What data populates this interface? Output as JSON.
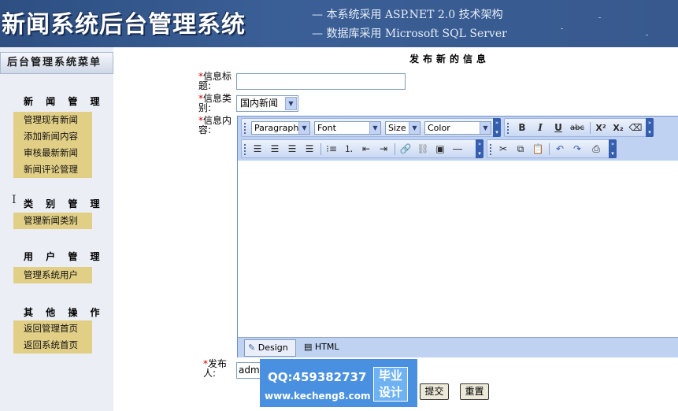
{
  "header": {
    "logo_text": "新闻系统后台管理系统",
    "line1": "— 本系统采用 ASP.NET 2.0 技术架构",
    "line2": "— 数据库采用 Microsoft SQL Server"
  },
  "sidebar": {
    "title": "后台管理系统菜单",
    "groups": [
      {
        "label": "新 闻 管 理",
        "items": [
          "管理现有新闻",
          "添加新闻内容",
          "审核最新新闻",
          "新闻评论管理"
        ]
      },
      {
        "label": "类 别 管 理",
        "items": [
          "管理新闻类别"
        ]
      },
      {
        "label": "用 户 管 理",
        "items": [
          "管理系统用户"
        ]
      },
      {
        "label": "其 他 操 作",
        "items": [
          "返回管理首页",
          "返回系统首页"
        ]
      }
    ]
  },
  "form": {
    "page_title": "发布新的信息",
    "required_mark": "*",
    "title_label": "信息标题:",
    "category_label": "信息类别:",
    "category_value": "国内新闻",
    "content_label": "信息内容:",
    "publisher_label": "发布人:",
    "publisher_value": "admin",
    "submit_label": "提交",
    "reset_label": "重置"
  },
  "editor": {
    "paragraph": "Paragraph",
    "font": "Font",
    "size": "Size",
    "color": "Color",
    "design_tab": "Design",
    "html_tab": "HTML",
    "buttons": {
      "bold": "B",
      "italic": "I",
      "underline": "U",
      "strike": "abc",
      "superscript": "X²",
      "subscript": "X₂"
    }
  },
  "watermark": {
    "qq": "QQ:459382737",
    "url": "www.kecheng8.com",
    "badge_line1": "毕业",
    "badge_line2": "设计"
  }
}
